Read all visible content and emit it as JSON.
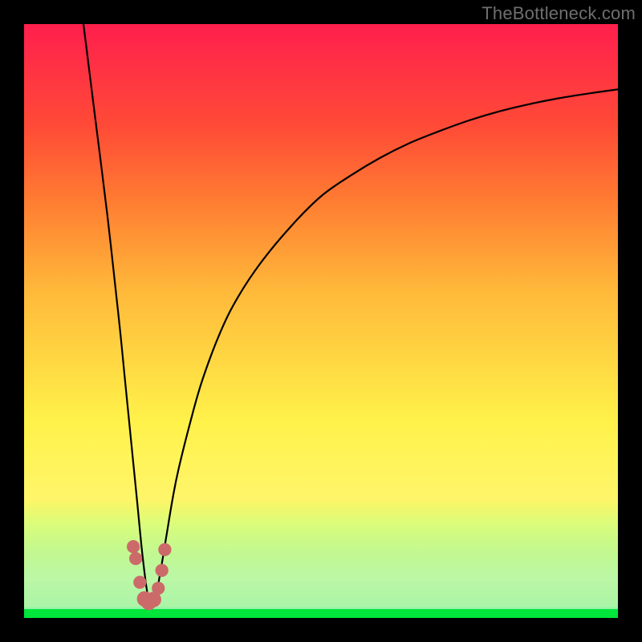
{
  "watermark": "TheBottleneck.com",
  "colors": {
    "page_bg": "#000000",
    "gradient_top": "#ff1f4d",
    "gradient_mid": "#ffb93a",
    "gradient_low": "#fff24a",
    "gradient_bottom": "#00e63b",
    "curve_stroke": "#000000",
    "marker_fill": "#cc6a6a",
    "watermark_color": "#6f6f6f"
  },
  "chart_data": {
    "type": "line",
    "title": "",
    "xlabel": "",
    "ylabel": "",
    "xlim": [
      0,
      100
    ],
    "ylim": [
      0,
      100
    ],
    "grid": false,
    "legend": false,
    "note": "Values are proportional estimates read from the image (0–100 plot-area units). The curve forms a deep V with minimum near x≈21, rising steeply on the left and gradually on the right.",
    "series": [
      {
        "name": "curve",
        "x": [
          10,
          12,
          14,
          16,
          17,
          18,
          19,
          20,
          21,
          22,
          23,
          24,
          25,
          26,
          28,
          30,
          33,
          36,
          40,
          45,
          50,
          55,
          60,
          65,
          70,
          75,
          80,
          85,
          90,
          95,
          100
        ],
        "y": [
          100,
          84,
          68,
          50,
          40,
          30,
          20,
          10,
          3,
          3,
          8,
          14,
          20,
          25,
          33,
          40,
          48,
          54,
          60,
          66,
          71,
          74.5,
          77.5,
          80,
          82,
          83.8,
          85.3,
          86.5,
          87.5,
          88.3,
          89
        ]
      }
    ],
    "markers": [
      {
        "x": 18.4,
        "y": 12,
        "r": 1.1
      },
      {
        "x": 18.8,
        "y": 10,
        "r": 1.1
      },
      {
        "x": 19.5,
        "y": 6,
        "r": 1.1
      },
      {
        "x": 20.3,
        "y": 3.2,
        "r": 1.3
      },
      {
        "x": 21.0,
        "y": 2.6,
        "r": 1.3
      },
      {
        "x": 21.8,
        "y": 3.1,
        "r": 1.3
      },
      {
        "x": 22.6,
        "y": 5,
        "r": 1.1
      },
      {
        "x": 23.2,
        "y": 8,
        "r": 1.1
      },
      {
        "x": 23.7,
        "y": 11.5,
        "r": 1.1
      }
    ]
  }
}
